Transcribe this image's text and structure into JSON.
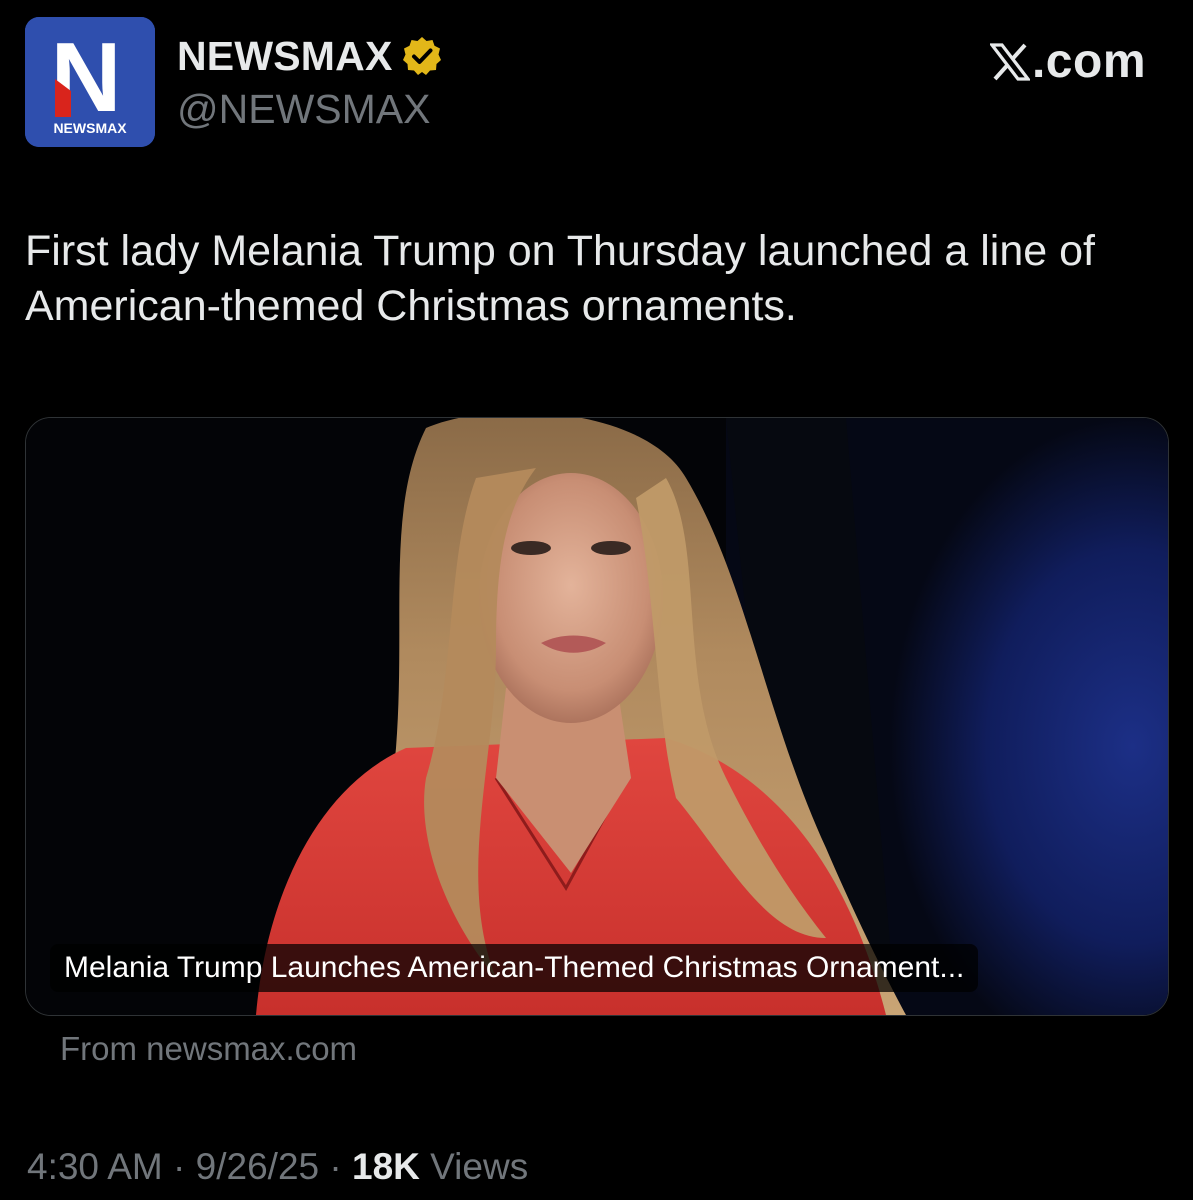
{
  "author": {
    "display_name": "NEWSMAX",
    "handle": "@NEWSMAX",
    "avatar": {
      "letter": "N",
      "label": "NEWSMAX",
      "bg_color": "#2f4fae"
    },
    "verified_badge_color": "#e2b719"
  },
  "source_brand": {
    "icon": "x-logo-icon",
    "label": ".com"
  },
  "tweet": {
    "text": "First lady Melania Trump on Thursday launched a line of American-themed Christmas ornaments."
  },
  "link_card": {
    "title": "Melania Trump Launches American-Themed Christmas Ornament...",
    "domain": "From newsmax.com"
  },
  "meta": {
    "time": "4:30 AM",
    "sep1": " · ",
    "date": "9/26/25",
    "sep2": " · ",
    "views_count": "18K",
    "views_label": " Views"
  }
}
